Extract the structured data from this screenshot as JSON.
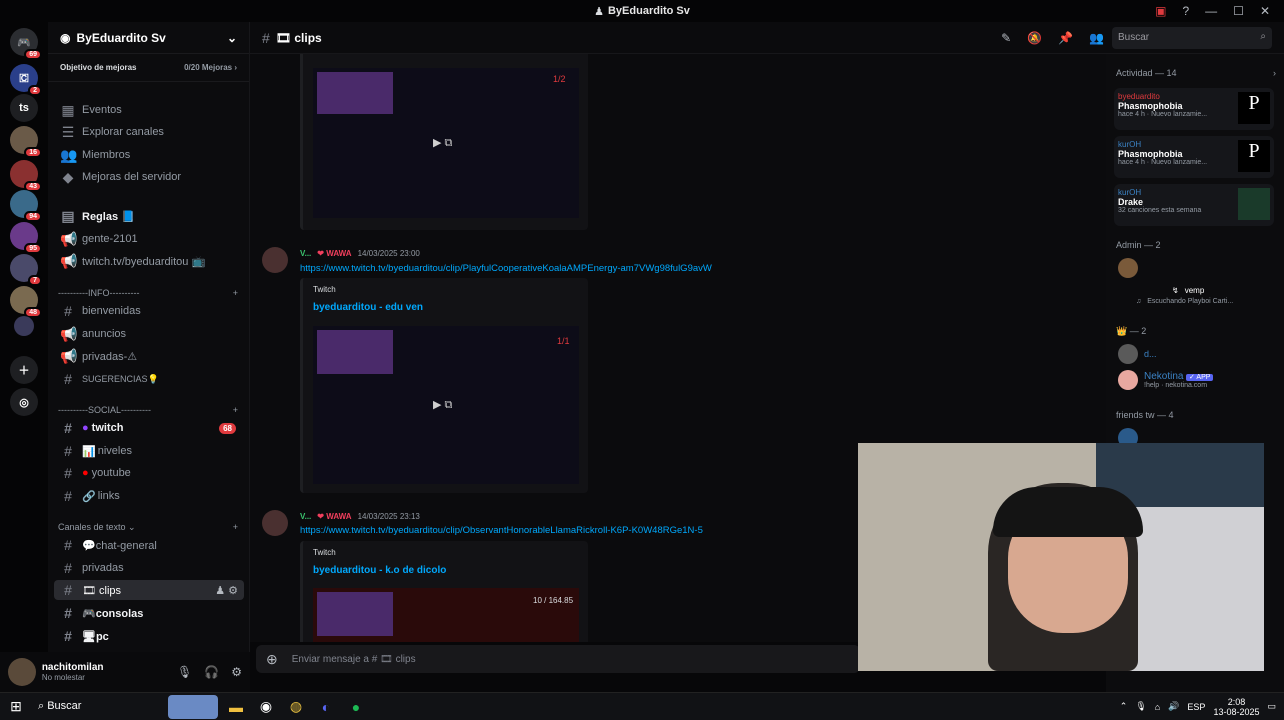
{
  "window": {
    "title": "ByEduardito Sv"
  },
  "server": {
    "name": "ByEduardito Sv",
    "goal_label": "Objetivo de mejoras",
    "goal_progress": "0/20 Mejoras",
    "menu": [
      "Eventos",
      "Explorar canales",
      "Miembros",
      "Mejoras del servidor"
    ],
    "top_channels": [
      "Reglas 📘",
      "gente-2101",
      "twitch.tv/byeduarditou 📺"
    ],
    "categories": {
      "info": "----------INFO----------",
      "social": "----------SOCIAL----------",
      "text": "Canales de texto"
    },
    "info_channels": [
      "bienvenidas",
      "anuncios",
      "privadas-⚠",
      "SUGERENCIAS💡"
    ],
    "social_channels": [
      "twitch",
      "niveles",
      "youtube",
      "links"
    ],
    "twitch_badge": "68",
    "text_channels": [
      "💬chat-general",
      "privadas",
      "🎞 clips",
      "🎮consolas",
      "🖥pc"
    ]
  },
  "guild_badges": [
    "69",
    "2",
    "16",
    "43",
    "94",
    "95",
    "7",
    "48"
  ],
  "guild_ts": "ts",
  "channel": {
    "name": "🎞 clips",
    "composer_placeholder": "Enviar mensaje a # 🎞 clips"
  },
  "search": {
    "placeholder": "Buscar"
  },
  "user": {
    "name": "nachitomilan",
    "status": "No molestar"
  },
  "messages": [
    {
      "author": "V...",
      "tag": "WAWA",
      "time": "14/03/2025 23:00",
      "link": "https://www.twitch.tv/byeduarditou/clip/PlayfulCooperativeKoalaAMPEnergy-am7VWg98fulG9avW",
      "provider": "Twitch",
      "title": "byeduarditou - edu ven",
      "counter": "1/1"
    },
    {
      "author": "V...",
      "tag": "WAWA",
      "time": "14/03/2025 23:13",
      "link": "https://www.twitch.tv/byeduarditou/clip/ObservantHonorableLlamaRickroll-K6P-K0W48RGe1N-5",
      "provider": "Twitch",
      "title": "byeduarditou - k.o de dicolo",
      "counter": "10 / 164.85"
    }
  ],
  "first_embed_counter": "1/2",
  "members": {
    "activity_header": "Actividad — 14",
    "activities": [
      {
        "name": "byeduardito",
        "game": "Phasmophobia",
        "sub": "hace 4 h  · Nuevo lanzamie..."
      },
      {
        "name": "kurOH",
        "game": "Phasmophobia",
        "sub": "hace 4 h  · Nuevo lanzamie..."
      },
      {
        "name": "kurOH",
        "game": "Drake",
        "sub": "32 canciones esta semana"
      }
    ],
    "admin_header": "Admin — 2",
    "admin_vemp": "vemp",
    "admin_listening": "Escuchando Playboi Carti...",
    "crown_header": "— 2",
    "crown_user1": "d...",
    "crown_user2": "Nekotina",
    "crown_user2_badge": "✓ APP",
    "crown_user2_sub": "!help · nekotina.com",
    "friends_header": "friends tw — 4"
  },
  "taskbar": {
    "search": "Buscar",
    "lang": "ESP",
    "time": "2:08",
    "date": "13-08-2025"
  },
  "colors": {
    "accent": "#00a8fc",
    "online": "#3bc46e",
    "alert": "#e03a3e"
  }
}
